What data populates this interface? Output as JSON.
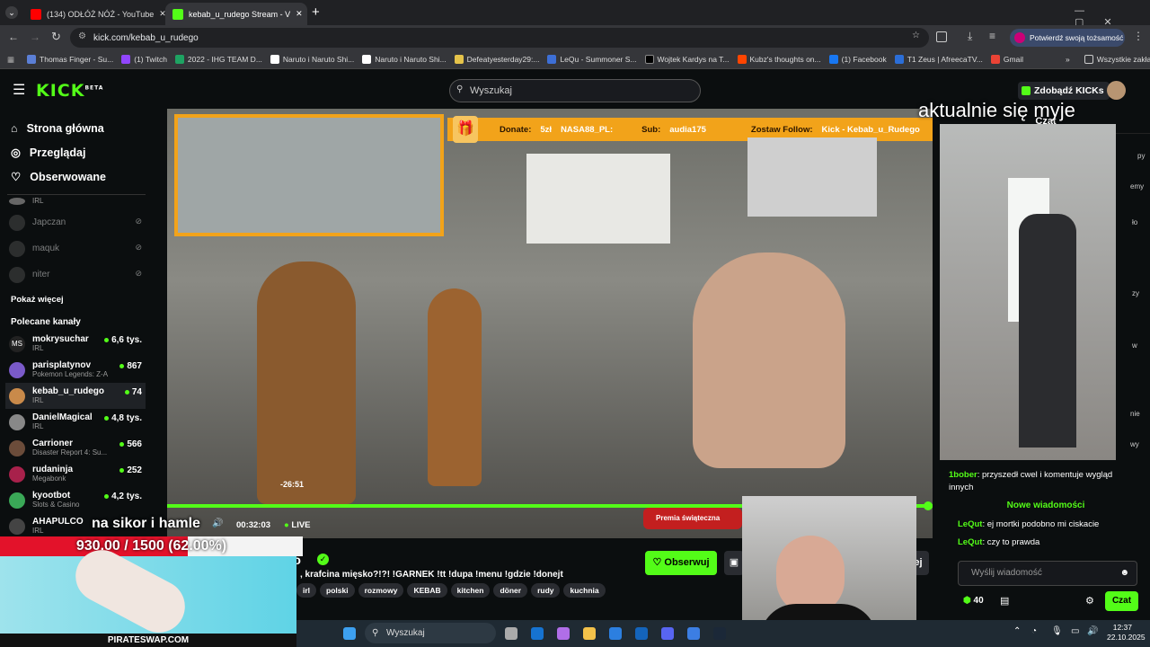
{
  "browser": {
    "tabs": [
      {
        "title": "(134) ODŁÓŻ NÓŻ - YouTube",
        "icon": "youtube-icon",
        "color": "#ff0000"
      },
      {
        "title": "kebab_u_rudego Stream - V",
        "icon": "kick-icon",
        "color": "#53fc18"
      }
    ],
    "url": "kick.com/kebab_u_rudego",
    "profile_button": "Potwierdź swoją tożsamość",
    "bookmarks": [
      "Thomas Finger - Su...",
      "(1) Twitch",
      "2022 - IHG TEAM D...",
      "Naruto i Naruto Shi...",
      "Naruto i Naruto Shi...",
      "Defeatyesterday29:...",
      "LeQu - Summoner S...",
      "Wojtek Kardys na T...",
      "Kubz's thoughts on...",
      "(1) Facebook",
      "T1 Zeus | AfreecaTV...",
      "Gmail"
    ],
    "bookmarks_more": "Wszystkie zakładki"
  },
  "kick": {
    "logo": "KICK",
    "logo_badge": "BETA",
    "search_placeholder": "Wyszukaj",
    "get_kicks": "Zdobądź KICKs",
    "nav": [
      "Strona główna",
      "Przeglądaj",
      "Obserwowane"
    ],
    "followed": [
      {
        "name": "",
        "category": "IRL"
      },
      {
        "name": "Japczan"
      },
      {
        "name": "maquk"
      },
      {
        "name": "niter"
      }
    ],
    "show_more": "Pokaż więcej",
    "recommended_title": "Polecane kanały",
    "recommended": [
      {
        "name": "mokrysuchar",
        "category": "IRL",
        "viewers": "6,6 tys.",
        "avatar": "MS"
      },
      {
        "name": "parisplatynov",
        "category": "Pokemon Legends: Z-A",
        "viewers": "867",
        "avatar": ""
      },
      {
        "name": "kebab_u_rudego",
        "category": "IRL",
        "viewers": "74",
        "avatar": ""
      },
      {
        "name": "DanielMagical",
        "category": "IRL",
        "viewers": "4,8 tys.",
        "avatar": ""
      },
      {
        "name": "Carrioner",
        "category": "Disaster Report 4: Su...",
        "viewers": "566",
        "avatar": ""
      },
      {
        "name": "rudaninja",
        "category": "Megabonk",
        "viewers": "252",
        "avatar": ""
      },
      {
        "name": "kyootbot",
        "category": "Slots & Casino",
        "viewers": "4,2 tys.",
        "avatar": ""
      },
      {
        "name": "AHAPULCO",
        "category": "IRL",
        "viewers": "",
        "avatar": ""
      }
    ],
    "stream_title": ", krafcina mięsko?!?! !GARNEK !tt !dupa !menu !gdzie !donejt",
    "channel_name": "ego",
    "tags": [
      "irl",
      "polski",
      "rozmowy",
      "KEBAB",
      "kitchen",
      "döner",
      "rudy",
      "kuchnia"
    ],
    "follow_button": "Obserwuj",
    "player": {
      "time": "00:32:03",
      "live": "LIVE",
      "hover_time": "-26:51"
    },
    "overlay": {
      "donate_label": "Donate:",
      "donate_value": "5zł",
      "donate_user": "NASA88_PL:",
      "sub_label": "Sub:",
      "sub_user": "audia175",
      "follow_label": "Zostaw Follow:",
      "follow_value": "Kick - Kebab_u_Rudego",
      "xmas": "Premia świąteczna"
    },
    "chat": {
      "header": "Czat",
      "messages": [
        {
          "user": "1bober",
          "text": "przyszedł cwel i komentuje wygląd innych",
          "color": "#53fc18"
        },
        {
          "user": "LeQut",
          "text": "ej mortki podobno mi ciskacie",
          "color": "#53fc18"
        },
        {
          "user": "LeQut",
          "text": "czy to prawda",
          "color": "#53fc18"
        }
      ],
      "new_messages": "Nowe wiadomości",
      "partial_lines": [
        "py",
        "emy",
        "ło",
        "zy",
        "w",
        "nie",
        "wy"
      ],
      "input_placeholder": "Wyślij wiadomość",
      "points": "40",
      "send": "Czat"
    }
  },
  "stream_overlays": {
    "caption": "aktualnie się myje",
    "subtitle": "na sikor i hamle",
    "goal": "930.00 / 1500 (62.00%)",
    "goal_fraction": 0.62,
    "ad_text": "PIRATESWAP.COM",
    "right_cut": "ej"
  },
  "taskbar": {
    "search": "Wyszukaj",
    "time": "12:37",
    "date": "22.10.2025"
  }
}
